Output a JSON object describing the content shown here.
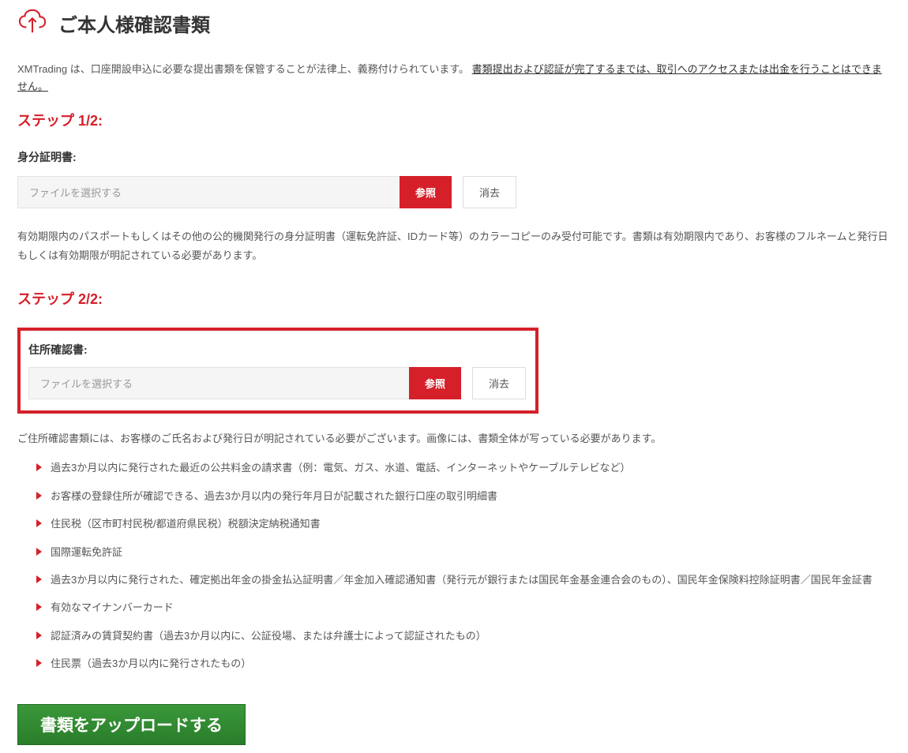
{
  "header": {
    "title": "ご本人様確認書類"
  },
  "intro": {
    "prefix": "XMTrading は、口座開設申込に必要な提出書類を保管することが法律上、義務付けられています。 ",
    "underlined": "書類提出および認証が完了するまでは、取引へのアクセスまたは出金を行うことはできません。"
  },
  "step1": {
    "heading": "ステップ 1/2:",
    "label": "身分証明書:",
    "placeholder": "ファイルを選択する",
    "browse": "参照",
    "clear": "消去",
    "description": "有効期限内のパスポートもしくはその他の公的機関発行の身分証明書（運転免許証、IDカード等）のカラーコピーのみ受付可能です。書類は有効期限内であり、お客様のフルネームと発行日もしくは有効期限が明記されている必要があります。"
  },
  "step2": {
    "heading": "ステップ 2/2:",
    "label": "住所確認書:",
    "placeholder": "ファイルを選択する",
    "browse": "参照",
    "clear": "消去",
    "listIntro": "ご住所確認書類には、お客様のご氏名および発行日が明記されている必要がございます。画像には、書類全体が写っている必要があります。",
    "items": [
      "過去3か月以内に発行された最近の公共料金の請求書（例：電気、ガス、水道、電話、インターネットやケーブルテレビなど）",
      "お客様の登録住所が確認できる、過去3か月以内の発行年月日が記載された銀行口座の取引明細書",
      "住民税（区市町村民税/都道府県民税）税額決定納税通知書",
      "国際運転免許証",
      "過去3か月以内に発行された、確定拠出年金の掛金払込証明書／年金加入確認通知書（発行元が銀行または国民年金基金連合会のもの）、国民年金保険料控除証明書／国民年金証書",
      "有効なマイナンバーカード",
      "認証済みの賃貸契約書（過去3か月以内に、公証役場、または弁護士によって認証されたもの）",
      "住民票（過去3か月以内に発行されたもの）"
    ]
  },
  "submit": {
    "label": "書類をアップロードする"
  }
}
